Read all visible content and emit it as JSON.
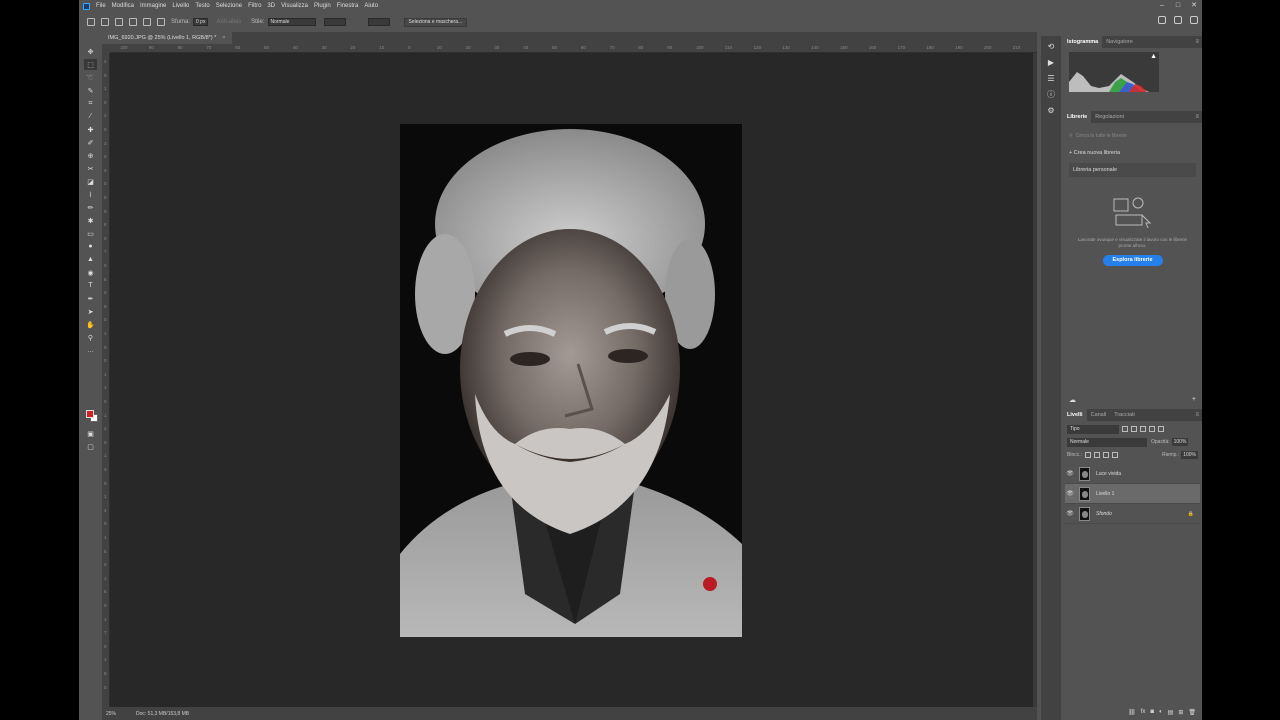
{
  "menubar": {
    "items": [
      "File",
      "Modifica",
      "Immagine",
      "Livello",
      "Testo",
      "Selezione",
      "Filtro",
      "3D",
      "Visualizza",
      "Plugin",
      "Finestra",
      "Aiuto"
    ]
  },
  "options": {
    "feather_label": "Sfuma:",
    "feather_value": "0 px",
    "antialias_label": "Anti-alias",
    "style_label": "Stile:",
    "style_value": "Normale",
    "select_mask_button": "Seleziona e maschera..."
  },
  "document": {
    "tab_title": "IMG_6920.JPG @ 25% (Livello 1, RGB/8*) *",
    "zoom": "25%",
    "doc_info": "Doc: 51,3 MB/153,8 MB"
  },
  "ruler": {
    "h_ticks": [
      "100",
      "90",
      "80",
      "70",
      "60",
      "50",
      "40",
      "30",
      "20",
      "10",
      "0",
      "10",
      "20",
      "30",
      "40",
      "50",
      "60",
      "70",
      "80",
      "90",
      "100",
      "110",
      "120",
      "130",
      "140",
      "150",
      "160",
      "170",
      "180",
      "190",
      "200",
      "210",
      "220"
    ],
    "v_ticks": [
      "2",
      "0",
      "1",
      "0",
      "2",
      "0",
      "3",
      "0",
      "4",
      "0",
      "5",
      "0",
      "6",
      "0",
      "7",
      "0",
      "8",
      "0",
      "9",
      "0",
      "1",
      "0",
      "0",
      "1",
      "1",
      "0",
      "1",
      "2",
      "0",
      "1",
      "3",
      "0",
      "1",
      "4",
      "0",
      "1",
      "5",
      "0",
      "1",
      "6",
      "0",
      "1",
      "7",
      "0",
      "1",
      "8",
      "0"
    ]
  },
  "histogram_panel": {
    "tabs": [
      "Istogramma",
      "Navigatore"
    ]
  },
  "libraries_panel": {
    "tabs": [
      "Librerie",
      "Regolazioni"
    ],
    "search_placeholder": "Cerca in tutte le librerie",
    "create_label": "Crea nuova libreria",
    "personal_library": "Libreria personale",
    "description": "Lavorate ovunque e visualizzate il lavoro con le librerie pronte all'uso.",
    "explore_button": "Esplora librerie"
  },
  "layers_panel": {
    "tabs": [
      "Livelli",
      "Canali",
      "Tracciati"
    ],
    "kind_filter": "Tipo",
    "blend_mode": "Normale",
    "opacity_label": "Opacità:",
    "opacity_value": "100%",
    "lock_label": "Blocc.:",
    "fill_label": "Riemp.:",
    "fill_value": "100%",
    "layers": [
      {
        "name": "Luce vivida",
        "selected": false,
        "locked": false
      },
      {
        "name": "Livello 1",
        "selected": true,
        "locked": false
      },
      {
        "name": "Sfondo",
        "selected": false,
        "locked": true
      }
    ]
  },
  "colors": {
    "foreground": "#d31f26",
    "background": "#ffffff",
    "accent": "#2680eb"
  }
}
